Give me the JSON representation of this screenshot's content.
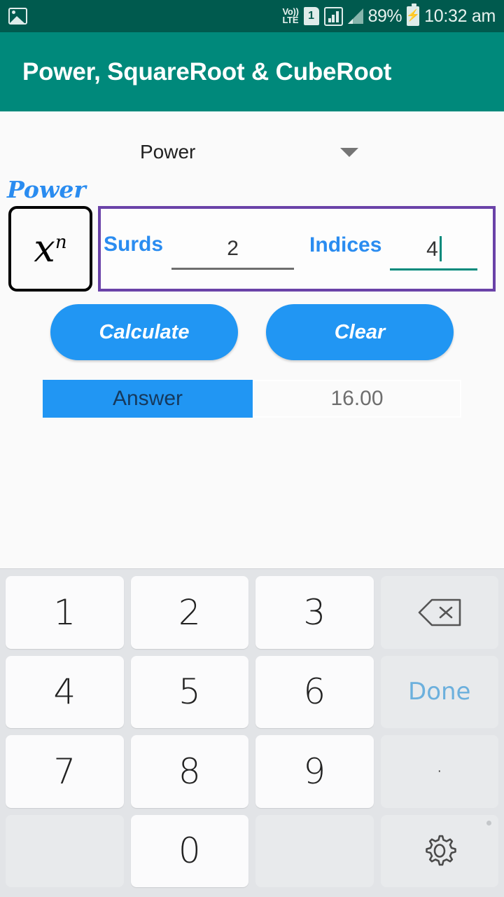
{
  "status_bar": {
    "notification_icon": "gallery-image-icon",
    "network_type": "Vo)) LTE",
    "volte_line1": "Vo))",
    "volte_line2": "LTE",
    "sim_label": "1",
    "signal_icon_1": "signal-bars-boxed-icon",
    "signal_icon_2": "signal-bars-icon",
    "battery_percent": "89%",
    "battery_icon": "battery-charging-icon",
    "battery_bolt": "⚡",
    "clock": "10:32 am"
  },
  "app_bar": {
    "title": "Power, SquareRoot & CubeRoot"
  },
  "mode_spinner": {
    "selected": "Power",
    "caret_icon": "chevron-down-icon",
    "options": [
      "Power"
    ]
  },
  "section": {
    "caption": "Power",
    "formula_icon_base": "x",
    "formula_icon_exponent": "n"
  },
  "inputs": {
    "surds": {
      "label": "Surds",
      "value": "2",
      "focused": false
    },
    "indices": {
      "label": "Indices",
      "value": "4",
      "focused": true
    }
  },
  "buttons": {
    "calculate": "Calculate",
    "clear": "Clear"
  },
  "answer": {
    "label": "Answer",
    "value": "16.00"
  },
  "keyboard": {
    "rows": [
      [
        {
          "label": "1",
          "name": "key-1",
          "type": "digit"
        },
        {
          "label": "2",
          "name": "key-2",
          "type": "digit"
        },
        {
          "label": "3",
          "name": "key-3",
          "type": "digit"
        },
        {
          "label": "",
          "name": "backspace-key",
          "type": "backspace"
        }
      ],
      [
        {
          "label": "4",
          "name": "key-4",
          "type": "digit"
        },
        {
          "label": "5",
          "name": "key-5",
          "type": "digit"
        },
        {
          "label": "6",
          "name": "key-6",
          "type": "digit"
        },
        {
          "label": "Done",
          "name": "done-key",
          "type": "done"
        }
      ],
      [
        {
          "label": "7",
          "name": "key-7",
          "type": "digit"
        },
        {
          "label": "8",
          "name": "key-8",
          "type": "digit"
        },
        {
          "label": "9",
          "name": "key-9",
          "type": "digit"
        },
        {
          "label": "·",
          "name": "decimal-key",
          "type": "dot"
        }
      ],
      [
        {
          "label": "",
          "name": "blank-key-left",
          "type": "blank"
        },
        {
          "label": "0",
          "name": "key-0",
          "type": "digit"
        },
        {
          "label": "",
          "name": "blank-key-right",
          "type": "blank"
        },
        {
          "label": "",
          "name": "settings-key",
          "type": "gear"
        }
      ]
    ]
  },
  "colors": {
    "status_bar": "#005a4e",
    "app_bar": "#00897b",
    "accent_blue": "#2196f3",
    "label_blue": "#2a8cf0",
    "border_purple": "#6a42a8",
    "focus_teal": "#00897b",
    "keyboard_bg": "#e2e4e7",
    "key_bg": "#fbfbfc",
    "func_key_bg": "#e8eaec",
    "done_blue": "#6cb0dd"
  }
}
